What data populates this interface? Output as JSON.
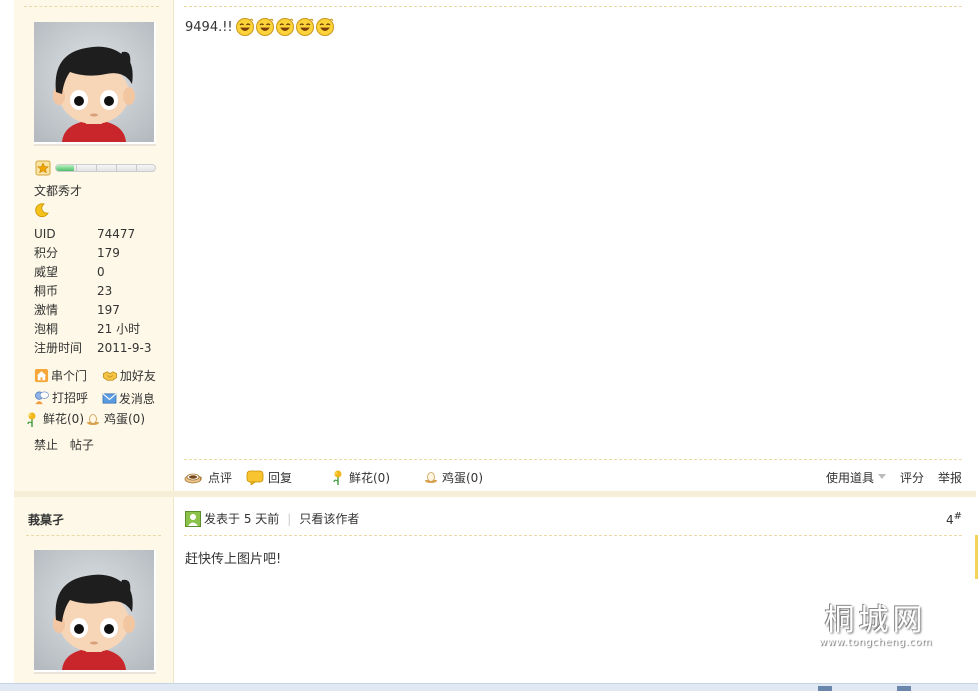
{
  "post1": {
    "level_fill": 0.18,
    "rank_title": "文都秀才",
    "stats": [
      {
        "key": "UID",
        "value": "74477"
      },
      {
        "key": "积分",
        "value": "179"
      },
      {
        "key": "威望",
        "value": "0"
      },
      {
        "key": "桐币",
        "value": "23"
      },
      {
        "key": "激情",
        "value": "197"
      },
      {
        "key": "泡桐",
        "value": "21 小时"
      },
      {
        "key": "注册时间",
        "value": "2011-9-3"
      }
    ],
    "actions": {
      "visit": "串个门",
      "add_friend": "加好友",
      "greet": "打招呼",
      "send_message": "发消息"
    },
    "gifts": {
      "flower": "鲜花(0)",
      "egg": "鸡蛋(0)"
    },
    "admin": {
      "ban": "禁止",
      "posts": "帖子"
    },
    "message_text": "9494.!!",
    "emoji_count": 5,
    "footer": {
      "comment": "点评",
      "reply": "回复",
      "flower": "鲜花(0)",
      "egg": "鸡蛋(0)",
      "use_tool": "使用道具",
      "rate": "评分",
      "report": "举报"
    }
  },
  "post2": {
    "author": "莪菒孑",
    "posted": "发表于 5 天前",
    "only_author": "只看该作者",
    "floor": "4",
    "floor_mark": "#",
    "message_text": "赶快传上图片吧!"
  },
  "watermark": {
    "main": "桐城网",
    "url": "www.tongcheng.com"
  },
  "colors": {
    "sidebar_bg": "#fdf8e7",
    "dash": "#ead9a6",
    "level_fill": "#4dbf6b"
  }
}
